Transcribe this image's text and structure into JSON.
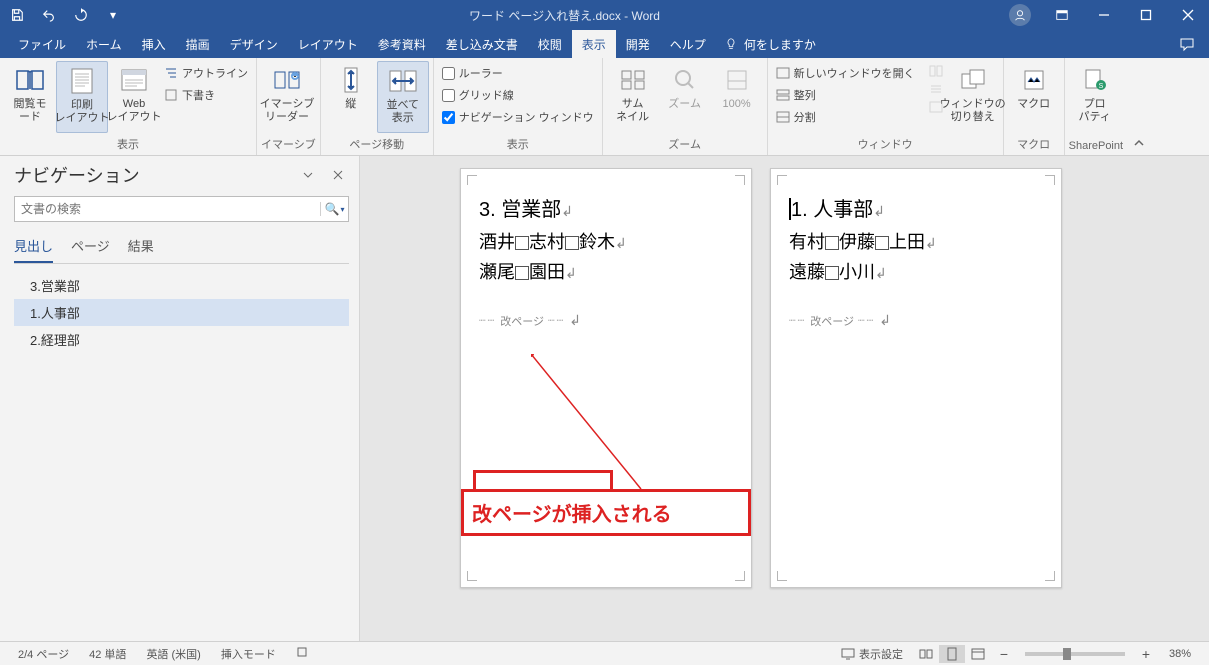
{
  "titlebar": {
    "title": "ワード ページ入れ替え.docx  -  Word"
  },
  "menubar": {
    "tabs": [
      "ファイル",
      "ホーム",
      "挿入",
      "描画",
      "デザイン",
      "レイアウト",
      "参考資料",
      "差し込み文書",
      "校閲",
      "表示",
      "開発",
      "ヘルプ"
    ],
    "active_index": 9,
    "tell_me": "何をしますか"
  },
  "ribbon": {
    "views": {
      "label": "表示",
      "read_mode": "閲覧モード",
      "print_layout": "印刷\nレイアウト",
      "web_layout": "Web\nレイアウト",
      "outline": "アウトライン",
      "draft": "下書き"
    },
    "immersive": {
      "label": "イマーシブ",
      "reader": "イマーシブ\nリーダー"
    },
    "page_move": {
      "label": "ページ移動",
      "vertical": "縦",
      "side": "並べて\n表示"
    },
    "show": {
      "label": "表示",
      "ruler": "ルーラー",
      "grid": "グリッド線",
      "nav": "ナビゲーション ウィンドウ"
    },
    "zoom": {
      "label": "ズーム",
      "thumb": "サム\nネイル",
      "zoom": "ズーム",
      "hundred": "100%"
    },
    "window": {
      "label": "ウィンドウ",
      "new": "新しいウィンドウを開く",
      "arrange": "整列",
      "split": "分割",
      "switch": "ウィンドウの\n切り替え"
    },
    "macro": {
      "label": "マクロ",
      "macros": "マクロ"
    },
    "sp": {
      "label": "SharePoint",
      "prop": "プロ\nパティ"
    }
  },
  "nav": {
    "title": "ナビゲーション",
    "search_placeholder": "文書の検索",
    "tabs": [
      "見出し",
      "ページ",
      "結果"
    ],
    "active_tab": 0,
    "items": [
      "3.営業部",
      "1.人事部",
      "2.経理部"
    ],
    "selected": 1
  },
  "doc": {
    "page1": {
      "heading": "3. 営業部",
      "line1_a": "酒井",
      "line1_b": "志村",
      "line1_c": "鈴木",
      "line2_a": "瀬尾",
      "line2_b": "園田",
      "pagebreak": "改ページ"
    },
    "page2": {
      "heading": "1. 人事部",
      "line1_a": "有村",
      "line1_b": "伊藤",
      "line1_c": "上田",
      "line2_a": "遠藤",
      "line2_b": "小川",
      "pagebreak": "改ページ"
    }
  },
  "annotation": {
    "text": "改ページが挿入される"
  },
  "status": {
    "page": "2/4 ページ",
    "words": "42 単語",
    "lang": "英語 (米国)",
    "insert": "挿入モード",
    "display": "表示設定",
    "zoom": "38%"
  }
}
